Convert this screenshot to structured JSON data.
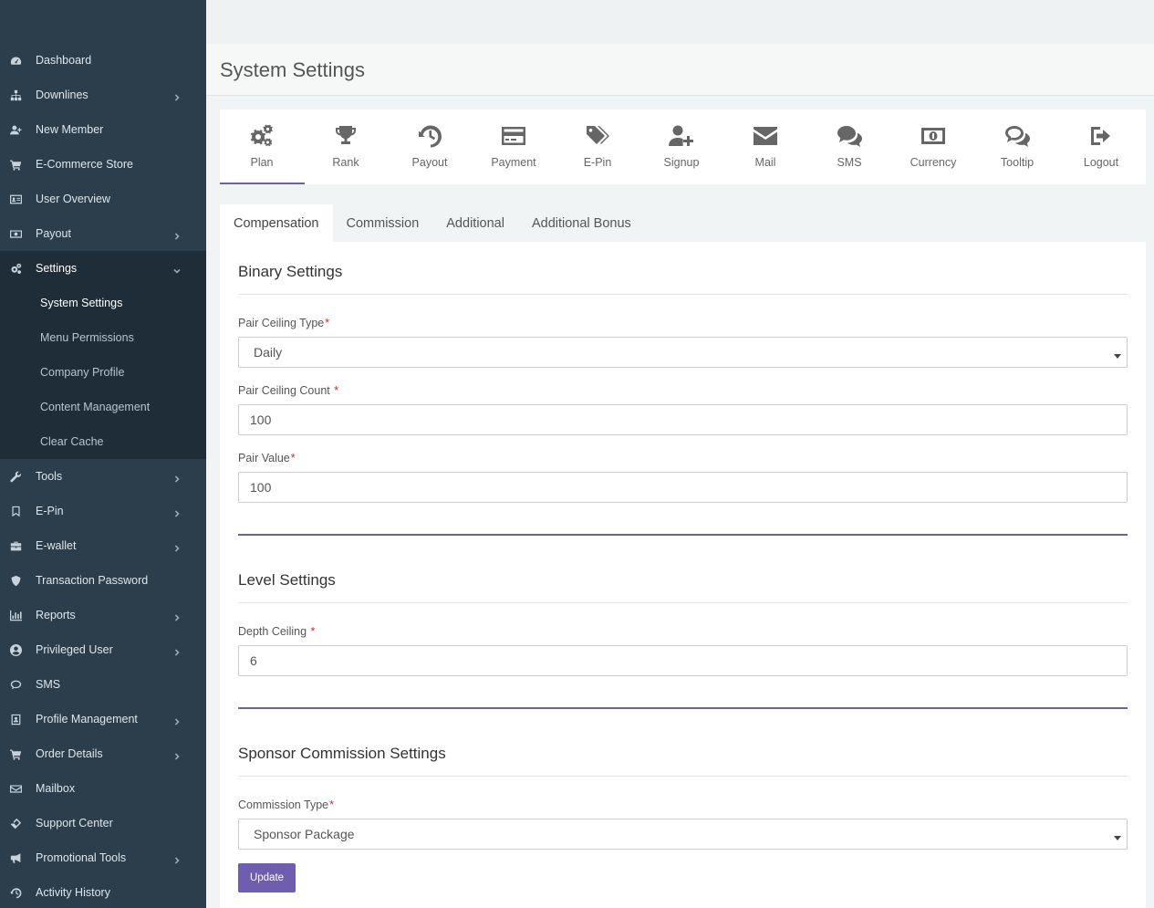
{
  "sidebar": {
    "items": [
      {
        "label": "Dashboard",
        "icon": "dashboard-icon"
      },
      {
        "label": "Downlines",
        "icon": "sitemap-icon"
      },
      {
        "label": "New Member",
        "icon": "user-plus-icon"
      },
      {
        "label": "E-Commerce Store",
        "icon": "cart-icon"
      },
      {
        "label": "User Overview",
        "icon": "id-card-icon"
      },
      {
        "label": "Payout",
        "icon": "money-icon"
      },
      {
        "label": "Settings",
        "icon": "gears-icon"
      },
      {
        "label": "Tools",
        "icon": "wrench-icon"
      },
      {
        "label": "E-Pin",
        "icon": "bookmark-icon"
      },
      {
        "label": "E-wallet",
        "icon": "briefcase-icon"
      },
      {
        "label": "Transaction Password",
        "icon": "shield-icon"
      },
      {
        "label": "Reports",
        "icon": "bar-chart-icon"
      },
      {
        "label": "Privileged User",
        "icon": "user-circle-icon"
      },
      {
        "label": "SMS",
        "icon": "comment-icon"
      },
      {
        "label": "Profile Management",
        "icon": "profile-icon"
      },
      {
        "label": "Order Details",
        "icon": "cart-icon"
      },
      {
        "label": "Mailbox",
        "icon": "envelope-icon"
      },
      {
        "label": "Support Center",
        "icon": "ticket-icon"
      },
      {
        "label": "Promotional Tools",
        "icon": "bullhorn-icon"
      },
      {
        "label": "Activity History",
        "icon": "history-icon"
      }
    ],
    "submenu": [
      {
        "label": "System Settings"
      },
      {
        "label": "Menu Permissions"
      },
      {
        "label": "Company Profile"
      },
      {
        "label": "Content Management"
      },
      {
        "label": "Clear Cache"
      }
    ]
  },
  "page": {
    "title": "System Settings"
  },
  "iconbar": [
    {
      "label": "Plan",
      "icon": "gears-icon"
    },
    {
      "label": "Rank",
      "icon": "trophy-icon"
    },
    {
      "label": "Payout",
      "icon": "history-icon"
    },
    {
      "label": "Payment",
      "icon": "credit-card-icon"
    },
    {
      "label": "E-Pin",
      "icon": "tags-icon"
    },
    {
      "label": "Signup",
      "icon": "user-plus-icon"
    },
    {
      "label": "Mail",
      "icon": "envelope-icon"
    },
    {
      "label": "SMS",
      "icon": "comments-icon"
    },
    {
      "label": "Currency",
      "icon": "money-icon"
    },
    {
      "label": "Tooltip",
      "icon": "comments-outline-icon"
    },
    {
      "label": "Logout",
      "icon": "sign-out-icon"
    }
  ],
  "tabs": [
    "Compensation",
    "Commission",
    "Additional",
    "Additional Bonus"
  ],
  "binary": {
    "title": "Binary Settings",
    "pair_ceiling_type_label": "Pair Ceiling Type",
    "pair_ceiling_type_value": "Daily",
    "pair_ceiling_count_label": "Pair Ceiling Count ",
    "pair_ceiling_count_value": "100",
    "pair_value_label": "Pair Value",
    "pair_value_value": "100"
  },
  "level": {
    "title": "Level Settings",
    "depth_ceiling_label": "Depth Ceiling ",
    "depth_ceiling_value": "6"
  },
  "sponsor": {
    "title": "Sponsor Commission Settings",
    "commission_type_label": "Commission Type",
    "commission_type_value": "Sponsor Package"
  },
  "actions": {
    "update_label": "Update"
  },
  "required_mark": "*",
  "colors": {
    "sidebar_bg": "#2c3e4c",
    "accent": "#6f5eb0",
    "required": "#d9261c"
  }
}
